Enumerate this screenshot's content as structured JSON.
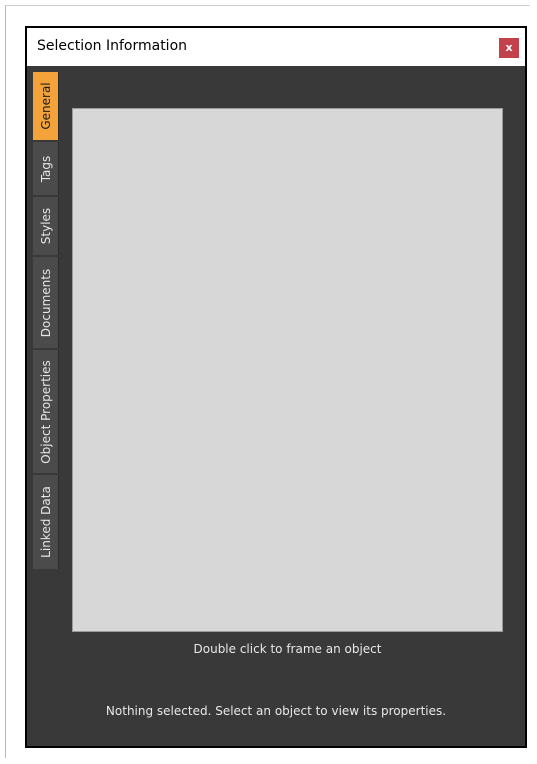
{
  "window": {
    "title": "Selection Information",
    "close_label": "x"
  },
  "tabs": [
    {
      "label": "General",
      "active": true
    },
    {
      "label": "Tags",
      "active": false
    },
    {
      "label": "Styles",
      "active": false
    },
    {
      "label": "Documents",
      "active": false
    },
    {
      "label": "Object Properties",
      "active": false
    },
    {
      "label": "Linked Data",
      "active": false
    }
  ],
  "preview": {
    "hint": "Double click to frame an object"
  },
  "status": {
    "message": "Nothing selected. Select an object to view its properties."
  },
  "colors": {
    "active_tab": "#f4a23a",
    "close_button": "#c3414a",
    "panel_background": "#393939",
    "preview_background": "#d7d7d7"
  }
}
